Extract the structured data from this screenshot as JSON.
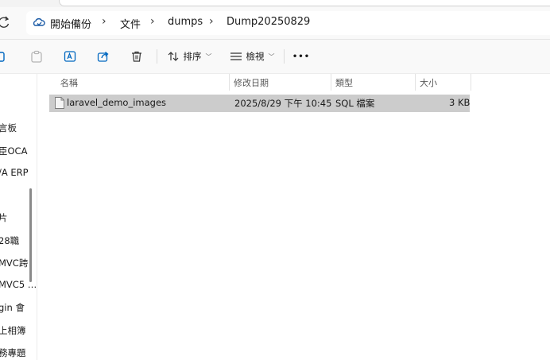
{
  "breadcrumb": {
    "items": [
      "開始備份",
      "文件",
      "dumps",
      "Dump20250829"
    ],
    "separator": "›"
  },
  "toolbar": {
    "sort_label": "排序",
    "view_label": "檢視",
    "more_label": "•••"
  },
  "sidebar": {
    "items": [
      "言板",
      "臣OCA",
      "/A ERP",
      "片",
      "28職",
      "MVC跨",
      "MVC5 …",
      "gin 會",
      "上相簿",
      "務專題"
    ]
  },
  "columns": {
    "name": "名稱",
    "modified": "修改日期",
    "type": "類型",
    "size": "大小"
  },
  "files": [
    {
      "name": "laravel_demo_images",
      "modified": "2025/8/29 下午 10:45",
      "type": "SQL 檔案",
      "size": "3 KB"
    }
  ],
  "colors": {
    "selected_row": "#cccccc",
    "accent": "#0067c0"
  }
}
